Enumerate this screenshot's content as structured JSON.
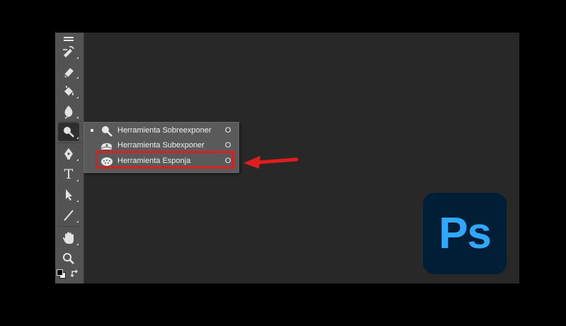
{
  "flyout": {
    "items": [
      {
        "label": "Herramienta Sobreexponer",
        "shortcut": "O",
        "icon": "dodge-icon",
        "selected": true
      },
      {
        "label": "Herramienta Subexponer",
        "shortcut": "O",
        "icon": "burn-icon",
        "selected": false
      },
      {
        "label": "Herramienta Esponja",
        "shortcut": "O",
        "icon": "sponge-icon",
        "selected": false
      }
    ]
  },
  "toolbar": {
    "tools": [
      "brush-partial-icon",
      "history-brush-icon",
      "eraser-icon",
      "paint-bucket-icon",
      "blur-icon",
      "dodge-icon",
      "pen-icon",
      "type-icon",
      "path-selection-icon",
      "line-icon",
      "hand-icon",
      "zoom-icon",
      "default-colors-icon",
      "swap-colors-icon"
    ],
    "type_tool_glyph": "T"
  },
  "logo": {
    "text": "Ps",
    "background": "#001e36",
    "color": "#31a8ff"
  },
  "colors": {
    "highlight": "#e01d1d",
    "arrow": "#e01d1d",
    "toolbar": "#535353",
    "canvas": "#282828"
  }
}
